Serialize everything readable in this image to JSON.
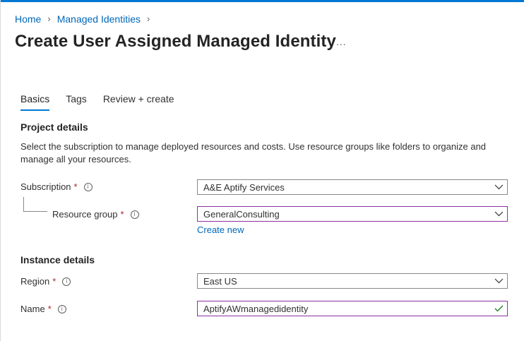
{
  "breadcrumb": {
    "items": [
      "Home",
      "Managed Identities"
    ]
  },
  "page": {
    "title": "Create User Assigned Managed Identity",
    "more_label": "..."
  },
  "tabs": [
    {
      "label": "Basics",
      "active": true
    },
    {
      "label": "Tags",
      "active": false
    },
    {
      "label": "Review + create",
      "active": false
    }
  ],
  "project": {
    "heading": "Project details",
    "description": "Select the subscription to manage deployed resources and costs. Use resource groups like folders to organize and manage all your resources."
  },
  "subscription": {
    "label": "Subscription",
    "required": "*",
    "value": "A&E Aptify Services"
  },
  "resource_group": {
    "label": "Resource group",
    "required": "*",
    "value": "GeneralConsulting",
    "create_new": "Create new"
  },
  "instance": {
    "heading": "Instance details"
  },
  "region": {
    "label": "Region",
    "required": "*",
    "value": "East US"
  },
  "name": {
    "label": "Name",
    "required": "*",
    "value": "AptifyAWmanagedidentity"
  },
  "info_glyph": "i",
  "colors": {
    "accent": "#0078d4",
    "link": "#0067b8",
    "required": "#a4262c",
    "focus_border": "#8e2fa4",
    "valid": "#107c10"
  }
}
